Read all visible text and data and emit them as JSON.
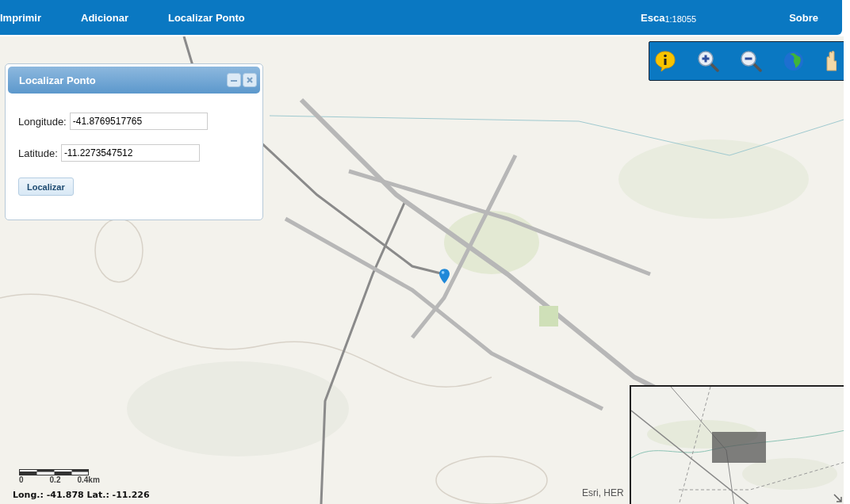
{
  "menu": {
    "items": [
      {
        "label": "Imprimir"
      },
      {
        "label": "Adicionar"
      },
      {
        "label": "Localizar Ponto"
      }
    ],
    "scale_label": "Esca",
    "scale_value": "1:18055",
    "about": "Sobre"
  },
  "dialog": {
    "title": "Localizar Ponto",
    "fields": [
      {
        "label": "Longitude:",
        "value": "-41.8769517765"
      },
      {
        "label": "Latitude:",
        "value": "-11.2273547512"
      }
    ],
    "button": "Localizar"
  },
  "scalebar": {
    "ticks": [
      "0",
      "0.2",
      "0.4km"
    ]
  },
  "coordinates": "Long.: -41.878 Lat.: -11.226",
  "attribution": "Esri, HER"
}
